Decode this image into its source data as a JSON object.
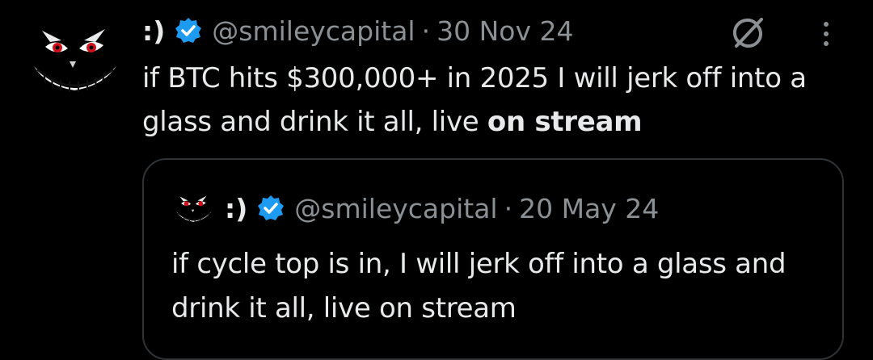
{
  "tweet": {
    "author_name": ":)",
    "handle": "@smileycapital",
    "separator": "·",
    "date": "30 Nov 24",
    "text_plain": "if BTC hits $300,000+ in 2025 I will jerk off into a glass and drink it all, live ",
    "text_bold": "on stream",
    "avatar_icon": "grinning-face-avatar-icon",
    "verified_color": "#1d9bf0"
  },
  "quote": {
    "author_name": ":)",
    "handle": "@smileycapital",
    "separator": "·",
    "date": "20 May 24",
    "text": "if cycle top is in, I will jerk off into a glass and drink it all, live on stream"
  },
  "colors": {
    "background": "#000000",
    "primary_text": "#e7e9ea",
    "secondary_text": "#8b9095",
    "border": "#2f3336",
    "eye_red": "#d0101a"
  }
}
